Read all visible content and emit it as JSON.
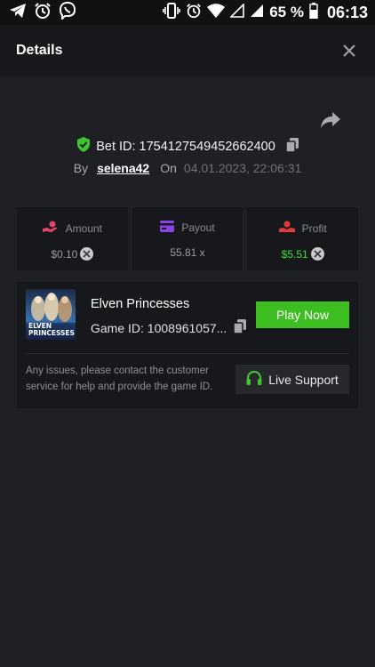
{
  "status_bar": {
    "battery_percent": "65 %",
    "time": "06:13",
    "left_icons": [
      "telegram-icon",
      "alarm-icon",
      "viber-icon"
    ],
    "right_icons": [
      "vibrate-icon",
      "alarm-icon",
      "wifi-icon",
      "signal-empty-icon",
      "signal-icon",
      "battery-icon"
    ]
  },
  "header": {
    "title": "Details",
    "close_icon": "close-icon"
  },
  "bet": {
    "id_text": "Bet ID: 1754127549452662400",
    "by_label": "By",
    "username": "selena42",
    "on_label": "On",
    "date": "04.01.2023, 22:06:31"
  },
  "stats": [
    {
      "label": "Amount",
      "value": "$0.10",
      "icon": "amount-icon",
      "icon_color": "#e8436f"
    },
    {
      "label": "Payout",
      "value": "55.81 x",
      "icon": "wallet-icon",
      "icon_color": "#8a44e6"
    },
    {
      "label": "Profit",
      "value": "$5.51",
      "icon": "profit-icon",
      "icon_color": "#e23a3a"
    }
  ],
  "game": {
    "name": "Elven Princesses",
    "id_text": "Game ID: 1008961057...",
    "play_label": "Play Now",
    "thumb_title_line1": "ELVEN",
    "thumb_title_line2": "PRINCESSES"
  },
  "support": {
    "text": "Any issues, please contact the customer service for help and provide the game ID.",
    "button_label": "Live Support"
  },
  "colors": {
    "accent_green": "#3dbf21",
    "profit_green": "#3ee03a",
    "background": "#1f2023",
    "card": "#17181b"
  }
}
